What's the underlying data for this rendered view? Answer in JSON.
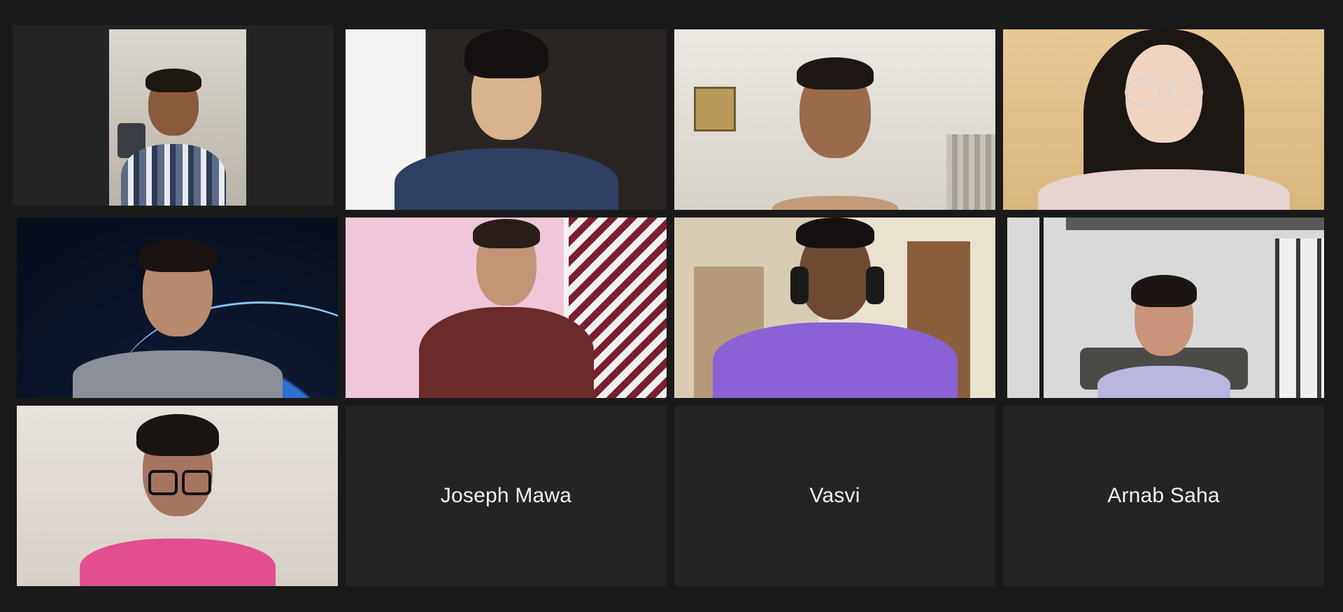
{
  "meeting": {
    "participants": [
      {
        "id": "p1",
        "type": "video",
        "active_speaker": true
      },
      {
        "id": "p2",
        "type": "video"
      },
      {
        "id": "p3",
        "type": "video"
      },
      {
        "id": "p4",
        "type": "video"
      },
      {
        "id": "p5",
        "type": "video"
      },
      {
        "id": "p6",
        "type": "video"
      },
      {
        "id": "p7",
        "type": "video"
      },
      {
        "id": "p8",
        "type": "video"
      },
      {
        "id": "p9",
        "type": "video"
      },
      {
        "id": "p10",
        "type": "name",
        "name": "Joseph Mawa"
      },
      {
        "id": "p11",
        "type": "name",
        "name": "Vasvi"
      },
      {
        "id": "p12",
        "type": "name",
        "name": "Arnab Saha"
      }
    ]
  },
  "colors": {
    "background": "#1a1a1a",
    "tile": "#242424",
    "active_speaker_border": "#d9e35c",
    "name_text": "#f2f2f2"
  }
}
